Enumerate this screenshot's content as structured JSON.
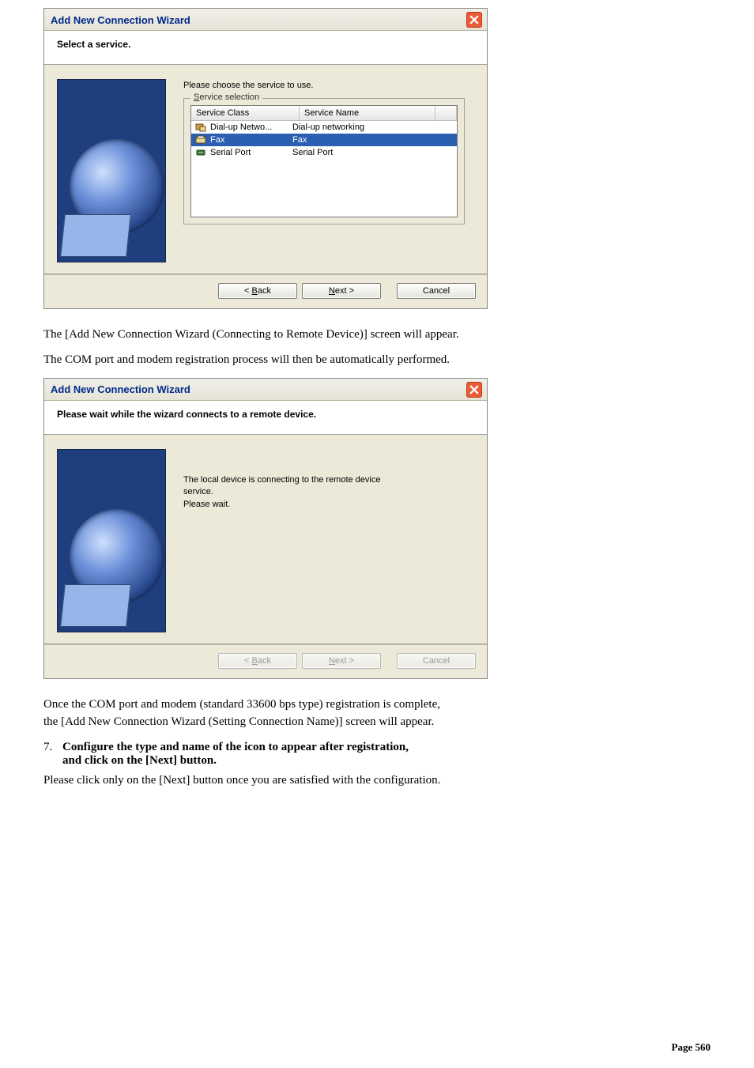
{
  "wizard1": {
    "title": "Add New Connection Wizard",
    "header": "Select a service.",
    "intro": "Please choose the service to use.",
    "group_legend_prefix": "S",
    "group_legend_rest": "ervice selection",
    "columns": {
      "c1": "Service Class",
      "c2": "Service Name"
    },
    "rows": [
      {
        "cls": "Dial-up Netwo...",
        "name": "Dial-up networking"
      },
      {
        "cls": "Fax",
        "name": "Fax"
      },
      {
        "cls": "Serial Port",
        "name": "Serial Port"
      }
    ],
    "buttons": {
      "back_prefix": "< ",
      "back_ul": "B",
      "back_rest": "ack",
      "next_ul": "N",
      "next_rest": "ext >",
      "cancel": "Cancel"
    }
  },
  "para1": "The [Add New Connection Wizard (Connecting to Remote Device)] screen will appear.",
  "para2": "The COM port and modem registration process will then be automatically performed.",
  "wizard2": {
    "title": "Add New Connection Wizard",
    "header": "Please wait while the wizard connects to a remote device.",
    "msg_line1": "The local device is connecting to the remote device",
    "msg_line2": "service.",
    "msg_line3": "Please wait.",
    "buttons": {
      "back_prefix": "< ",
      "back_ul": "B",
      "back_rest": "ack",
      "next_ul": "N",
      "next_rest": "ext >",
      "cancel": "Cancel"
    }
  },
  "para3a": "Once the COM port and modem (standard 33600 bps type) registration is complete,",
  "para3b": "the [Add New Connection Wizard (Setting Connection Name)] screen will appear.",
  "step": {
    "num": "7.",
    "line1": "Configure the type and name of the icon to appear after registration,",
    "line2": "and click on the [Next] button."
  },
  "para4": "Please click only on the [Next] button once you are satisfied with the configuration.",
  "footer": "Page 560"
}
